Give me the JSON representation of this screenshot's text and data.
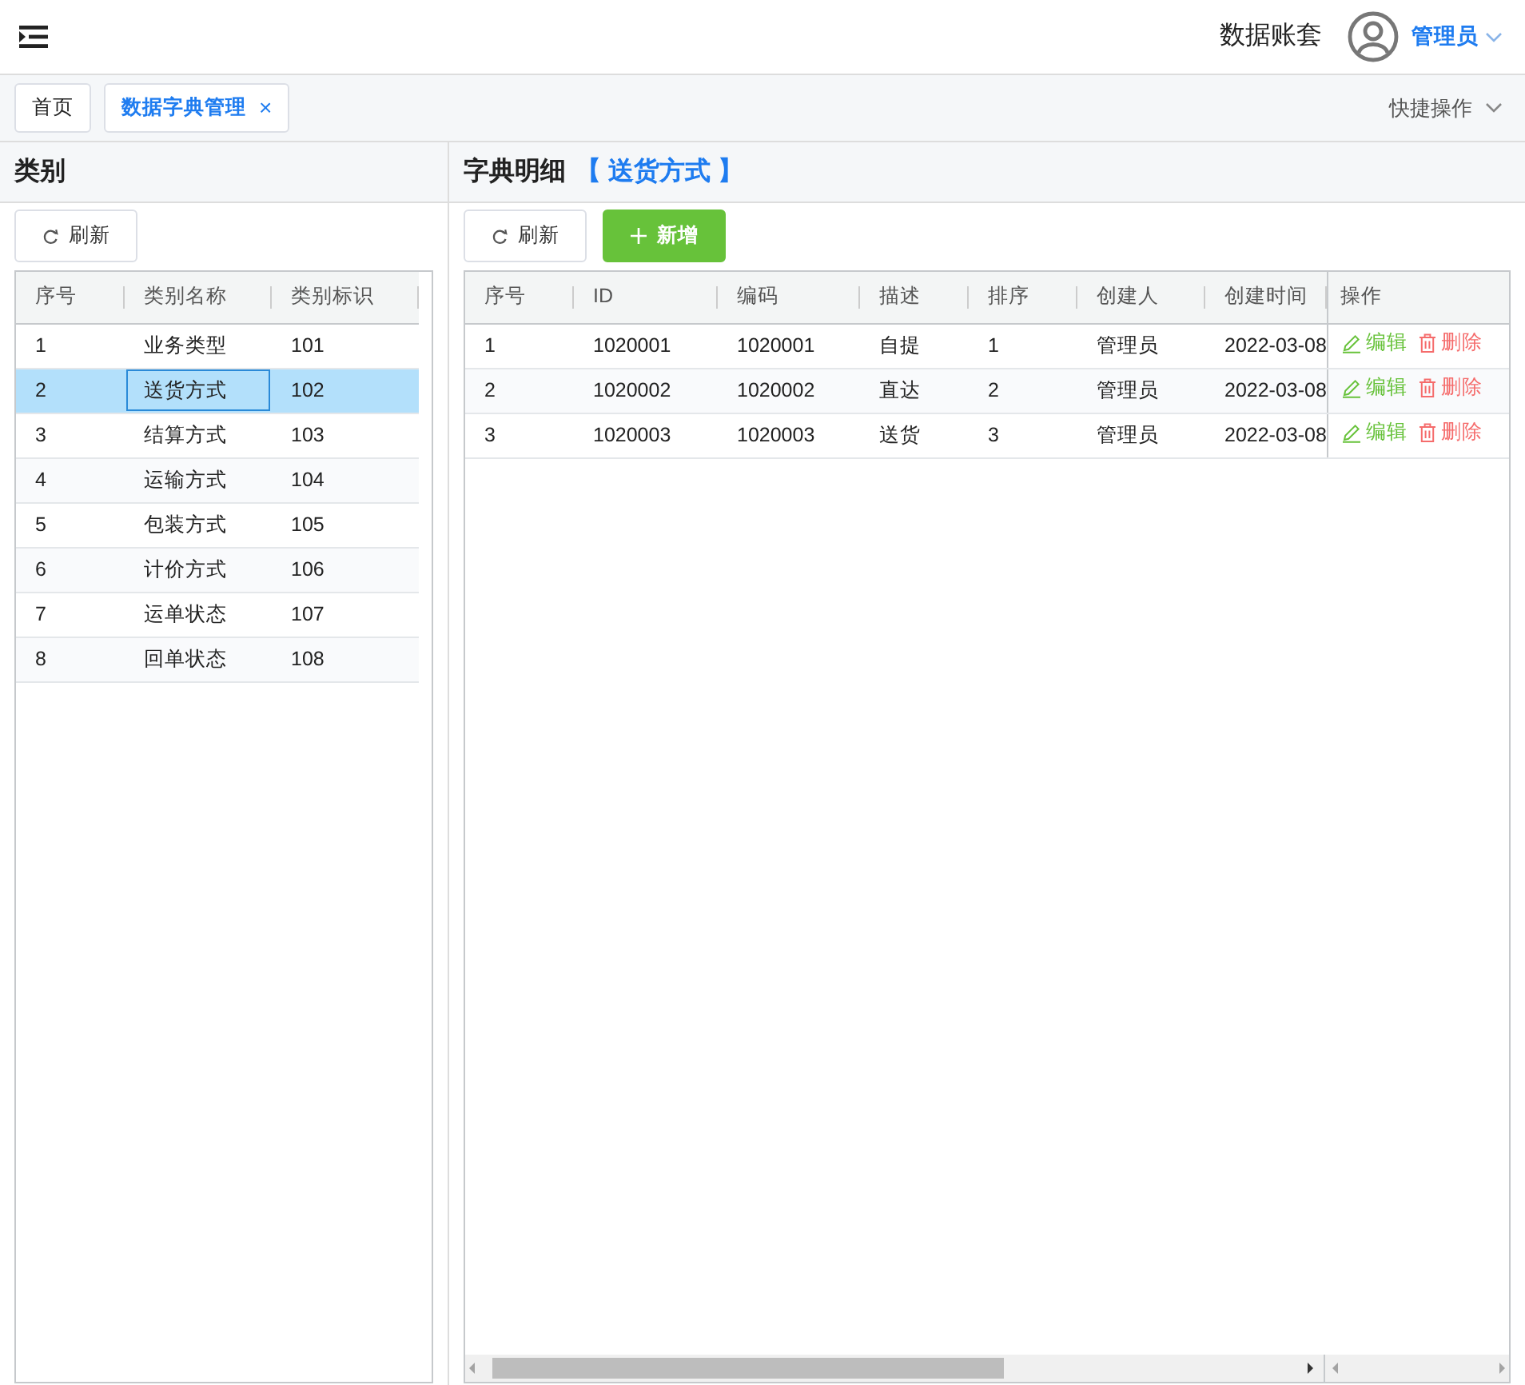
{
  "header": {
    "account_set": "数据账套",
    "user": "管理员"
  },
  "tabs": [
    {
      "label": "首页",
      "selected": false
    },
    {
      "label": "数据字典管理",
      "selected": true,
      "close": "×"
    }
  ],
  "quick_actions": "快捷操作",
  "category_panel": {
    "title": "类别",
    "refresh_button": "刷新",
    "table": {
      "columns": [
        "序号",
        "类别名称",
        "类别标识"
      ],
      "rows": [
        {
          "cells": [
            "1",
            "业务类型",
            "101"
          ],
          "selected": false
        },
        {
          "cells": [
            "2",
            "送货方式",
            "102"
          ],
          "selected": true
        },
        {
          "cells": [
            "3",
            "结算方式",
            "103"
          ],
          "selected": false
        },
        {
          "cells": [
            "4",
            "运输方式",
            "104"
          ],
          "selected": false
        },
        {
          "cells": [
            "5",
            "包装方式",
            "105"
          ],
          "selected": false
        },
        {
          "cells": [
            "6",
            "计价方式",
            "106"
          ],
          "selected": false
        },
        {
          "cells": [
            "7",
            "运单状态",
            "107"
          ],
          "selected": false
        },
        {
          "cells": [
            "8",
            "回单状态",
            "108"
          ],
          "selected": false
        }
      ]
    }
  },
  "detail_panel": {
    "title": "字典明细",
    "current_category": "【 送货方式 】",
    "refresh_button": "刷新",
    "add_button": "新增",
    "table": {
      "columns": [
        "序号",
        "ID",
        "编码",
        "描述",
        "排序",
        "创建人",
        "创建时间",
        "操作"
      ],
      "rows": [
        {
          "cells": [
            "1",
            "1020001",
            "1020001",
            "自提",
            "1",
            "管理员",
            "2022-03-08"
          ],
          "actions": [
            {
              "kind": "edit",
              "label": "编辑"
            },
            {
              "kind": "delete",
              "label": "删除"
            }
          ]
        },
        {
          "cells": [
            "2",
            "1020002",
            "1020002",
            "直达",
            "2",
            "管理员",
            "2022-03-08"
          ],
          "actions": [
            {
              "kind": "edit",
              "label": "编辑"
            },
            {
              "kind": "delete",
              "label": "删除"
            }
          ]
        },
        {
          "cells": [
            "3",
            "1020003",
            "1020003",
            "送货",
            "3",
            "管理员",
            "2022-03-08"
          ],
          "actions": [
            {
              "kind": "edit",
              "label": "编辑"
            },
            {
              "kind": "delete",
              "label": "删除"
            }
          ]
        }
      ]
    }
  }
}
